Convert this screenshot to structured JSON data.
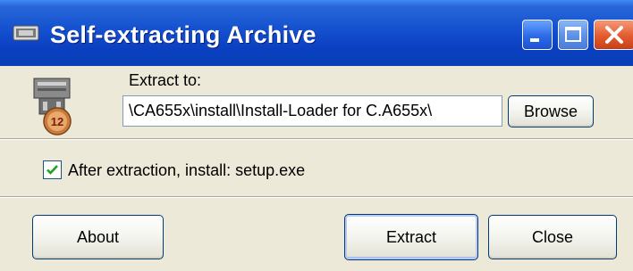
{
  "window": {
    "title": "Self-extracting Archive",
    "icons": {
      "app": "archive-window-icon",
      "minimize": "minimize-icon",
      "maximize": "maximize-icon",
      "close": "close-icon"
    }
  },
  "extract": {
    "label": "Extract to:",
    "path_value": "\\CA655x\\install\\Install-Loader for C.A655x\\",
    "browse_label": "Browse",
    "archive_icon": "archive-icon",
    "archive_badge": "12"
  },
  "options": {
    "install_checked": true,
    "install_label": "After extraction, install: setup.exe"
  },
  "buttons": {
    "about": "About",
    "extract": "Extract",
    "close": "Close"
  },
  "colors": {
    "titlebar": "#0a3fc0",
    "dialog_bg": "#ece9d8",
    "close_button": "#e35a2d",
    "checkmark": "#21a121"
  }
}
